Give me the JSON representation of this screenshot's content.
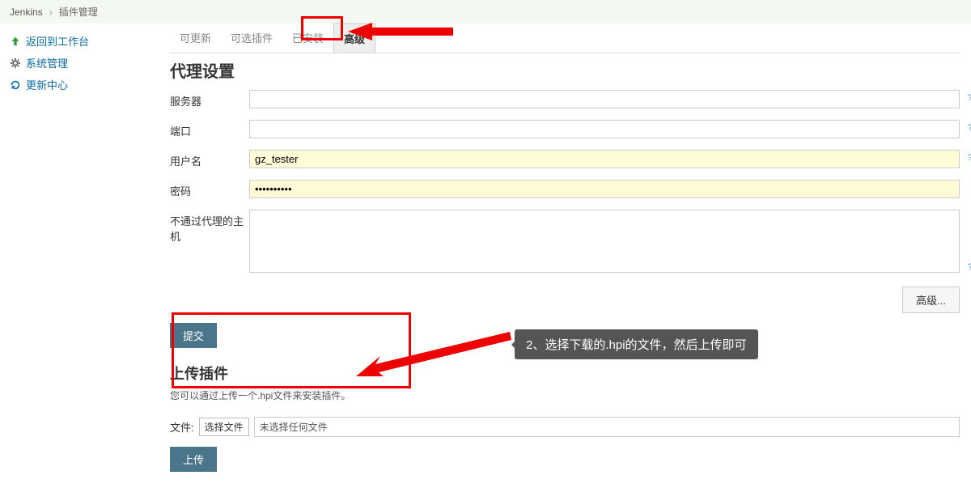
{
  "breadcrumb": {
    "root": "Jenkins",
    "current": "插件管理"
  },
  "sidebar": {
    "items": [
      {
        "label": "返回到工作台",
        "icon": "arrow-up"
      },
      {
        "label": "系统管理",
        "icon": "gear"
      },
      {
        "label": "更新中心",
        "icon": "refresh"
      }
    ]
  },
  "tabs": {
    "items": [
      {
        "label": "可更新",
        "active": false
      },
      {
        "label": "可选插件",
        "active": false
      },
      {
        "label": "已安装",
        "active": false
      },
      {
        "label": "高级",
        "active": true
      }
    ]
  },
  "proxy": {
    "title": "代理设置",
    "fields": {
      "server": {
        "label": "服务器",
        "value": ""
      },
      "port": {
        "label": "端口",
        "value": ""
      },
      "user": {
        "label": "用户名",
        "value": "gz_tester"
      },
      "password": {
        "label": "密码",
        "value": "••••••••••"
      },
      "noproxy": {
        "label": "不通过代理的主机",
        "value": ""
      }
    },
    "advanced_btn": "高级...",
    "submit_btn": "提交"
  },
  "upload": {
    "title": "上传插件",
    "desc": "您可以通过上传一个.hpi文件来安装插件。",
    "file_label": "文件:",
    "choose_label": "选择文件",
    "no_file": "未选择任何文件",
    "submit_btn": "上传"
  },
  "annotations": {
    "callout": "2、选择下载的.hpi的文件，然后上传即可"
  }
}
